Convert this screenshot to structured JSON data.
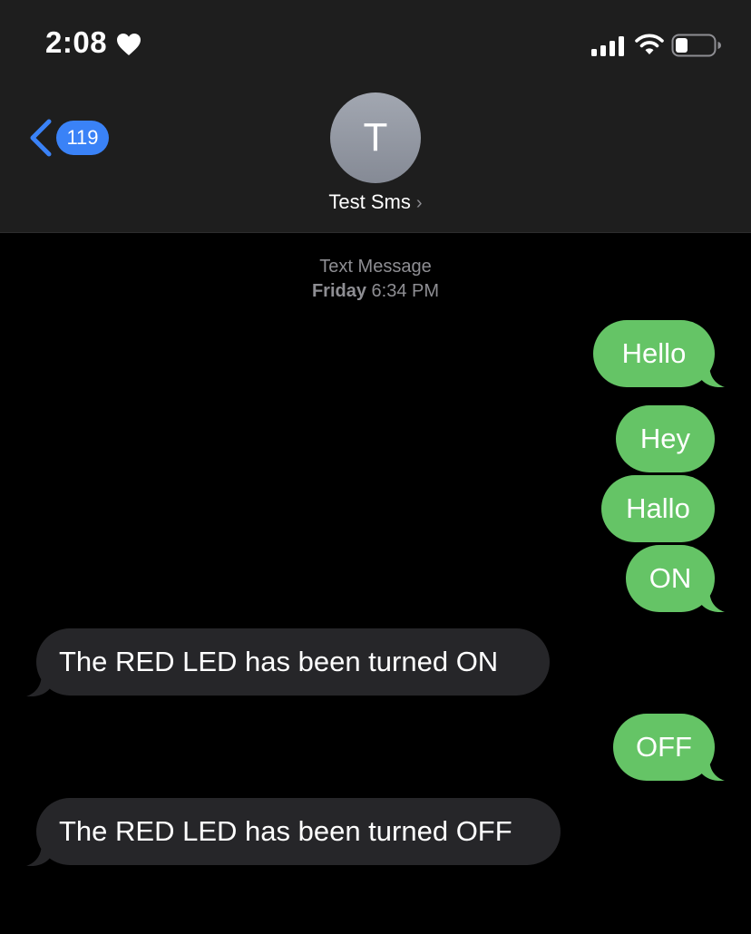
{
  "status_bar": {
    "time": "2:08",
    "icons": [
      "heart-icon",
      "cellular-signal-icon",
      "wifi-icon",
      "battery-icon"
    ]
  },
  "header": {
    "back_count": "119",
    "avatar_initial": "T",
    "contact_name": "Test Sms",
    "chevron": "›"
  },
  "conversation": {
    "service_label": "Text Message",
    "timestamp_day": "Friday",
    "timestamp_time": "6:34 PM",
    "messages": [
      {
        "direction": "sent",
        "text": "Hello"
      },
      {
        "direction": "sent",
        "text": "Hey"
      },
      {
        "direction": "sent",
        "text": "Hallo"
      },
      {
        "direction": "sent",
        "text": "ON"
      },
      {
        "direction": "received",
        "text": "The RED LED has been turned ON"
      },
      {
        "direction": "sent",
        "text": "OFF"
      },
      {
        "direction": "received",
        "text": "The RED LED has been turned OFF"
      }
    ]
  },
  "colors": {
    "sent_bubble": "#65c466",
    "received_bubble": "#262629",
    "accent_blue": "#3a82f7",
    "header_bg": "#1e1e1e"
  }
}
